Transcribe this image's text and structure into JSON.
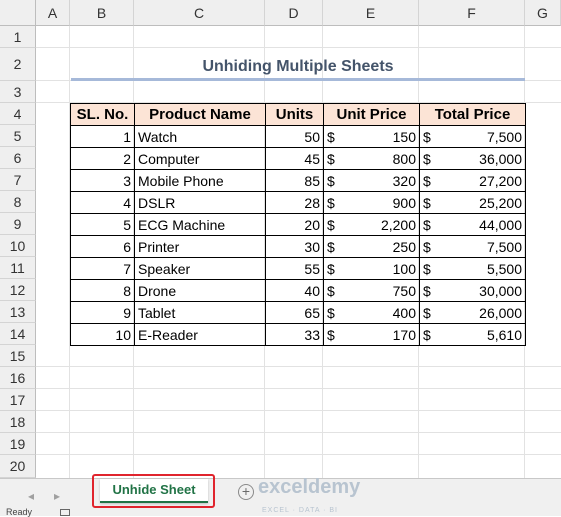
{
  "columns": [
    "A",
    "B",
    "C",
    "D",
    "E",
    "F",
    "G"
  ],
  "rows": [
    "1",
    "2",
    "3",
    "4",
    "5",
    "6",
    "7",
    "8",
    "9",
    "10",
    "11",
    "12",
    "13",
    "14",
    "15",
    "16",
    "17",
    "18",
    "19",
    "20"
  ],
  "title": "Unhiding Multiple Sheets",
  "table": {
    "headers": [
      "SL. No.",
      "Product Name",
      "Units",
      "Unit Price",
      "Total Price"
    ],
    "currency_symbol": "$",
    "rows": [
      {
        "sl": "1",
        "product": "Watch",
        "units": "50",
        "unit_price": "150",
        "total": "7,500"
      },
      {
        "sl": "2",
        "product": "Computer",
        "units": "45",
        "unit_price": "800",
        "total": "36,000"
      },
      {
        "sl": "3",
        "product": "Mobile Phone",
        "units": "85",
        "unit_price": "320",
        "total": "27,200"
      },
      {
        "sl": "4",
        "product": "DSLR",
        "units": "28",
        "unit_price": "900",
        "total": "25,200"
      },
      {
        "sl": "5",
        "product": "ECG Machine",
        "units": "20",
        "unit_price": "2,200",
        "total": "44,000"
      },
      {
        "sl": "6",
        "product": "Printer",
        "units": "30",
        "unit_price": "250",
        "total": "7,500"
      },
      {
        "sl": "7",
        "product": "Speaker",
        "units": "55",
        "unit_price": "100",
        "total": "5,500"
      },
      {
        "sl": "8",
        "product": "Drone",
        "units": "40",
        "unit_price": "750",
        "total": "30,000"
      },
      {
        "sl": "9",
        "product": "Tablet",
        "units": "65",
        "unit_price": "400",
        "total": "26,000"
      },
      {
        "sl": "10",
        "product": "E-Reader",
        "units": "33",
        "unit_price": "170",
        "total": "5,610"
      }
    ]
  },
  "sheet_tabs": {
    "nav_prev": "◂",
    "nav_next": "▸",
    "active_tab": "Unhide Sheet",
    "add_symbol": "+"
  },
  "watermark": {
    "brand": "exceldemy",
    "tagline": "EXCEL · DATA · BI"
  },
  "status": {
    "ready": "Ready"
  },
  "colors": {
    "header_fill": "#fce4d6",
    "tab_accent": "#217346",
    "highlight": "#e0242d",
    "title": "#44546a"
  }
}
